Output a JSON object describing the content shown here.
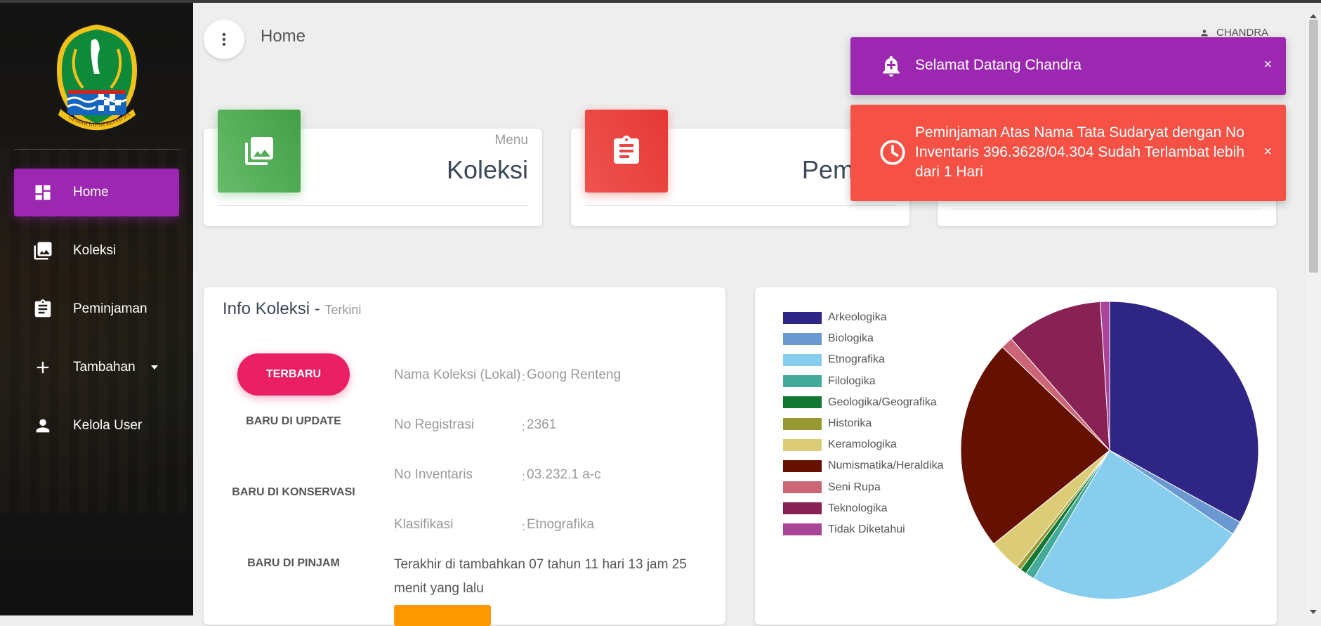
{
  "header": {
    "title": "Home",
    "user_name": "CHANDRA"
  },
  "sidebar": {
    "logo_text": "GEMAH RIPAH REPEH RAPIH",
    "items": [
      {
        "label": "Home",
        "icon": "dashboard-icon",
        "active": true
      },
      {
        "label": "Koleksi",
        "icon": "photo-library-icon",
        "active": false
      },
      {
        "label": "Peminjaman",
        "icon": "clipboard-icon",
        "active": false
      },
      {
        "label": "Tambahan",
        "icon": "plus-icon",
        "active": false
      },
      {
        "label": "Kelola User",
        "icon": "person-icon",
        "active": false
      }
    ]
  },
  "cards": [
    {
      "category": "Menu",
      "title": "Koleksi",
      "color": "#4caf50",
      "icon": "photo-library-icon"
    },
    {
      "category": "",
      "title": "Peminjaman",
      "color": "#f44336",
      "icon": "clipboard-icon"
    }
  ],
  "notifications": [
    {
      "text": "Selamat Datang Chandra",
      "color": "#9c27b0",
      "icon": "notification-bell-icon",
      "close": "×"
    },
    {
      "text": "Peminjaman Atas Nama Tata Sudaryat dengan No Inventaris 396.3628/04.304 Sudah Terlambat lebih dari 1 Hari",
      "color": "#f55145",
      "icon": "clock-icon",
      "close": "×"
    }
  ],
  "info": {
    "title": "Info Koleksi - ",
    "subtitle": "Terkini",
    "tabs": [
      "TERBARU",
      "BARU DI UPDATE",
      "BARU DI KONSERVASI",
      "BARU DI PINJAM"
    ],
    "fields": [
      {
        "label": "Nama Koleksi (Lokal)",
        "sep": ":",
        "value": "Goong Renteng"
      },
      {
        "label": "No Registrasi",
        "sep": ":",
        "value": "2361"
      },
      {
        "label": "No Inventaris",
        "sep": ":",
        "value": "03.232.1 a-c"
      },
      {
        "label": "Klasifikasi",
        "sep": ":",
        "value": "Etnografika"
      }
    ],
    "last_added": "Terakhir di tambahkan 07 tahun 11 hari 13 jam 25 menit yang lalu"
  },
  "chart_data": {
    "type": "pie",
    "categories": [
      "Arkeologika",
      "Biologika",
      "Etnografika",
      "Filologika",
      "Geologika/Geografika",
      "Historika",
      "Keramologika",
      "Numismatika/Heraldika",
      "Seni Rupa",
      "Teknologika",
      "Tidak Diketahui"
    ],
    "values": [
      33.0,
      1.5,
      24.0,
      1.0,
      0.7,
      0.5,
      3.5,
      23.0,
      1.3,
      10.5,
      1.0
    ],
    "colors": [
      "#2e2585",
      "#6999d0",
      "#87cdee",
      "#44aa99",
      "#117733",
      "#999933",
      "#ddcc77",
      "#661100",
      "#cc6677",
      "#882255",
      "#aa4499"
    ],
    "legend_position": "left"
  }
}
